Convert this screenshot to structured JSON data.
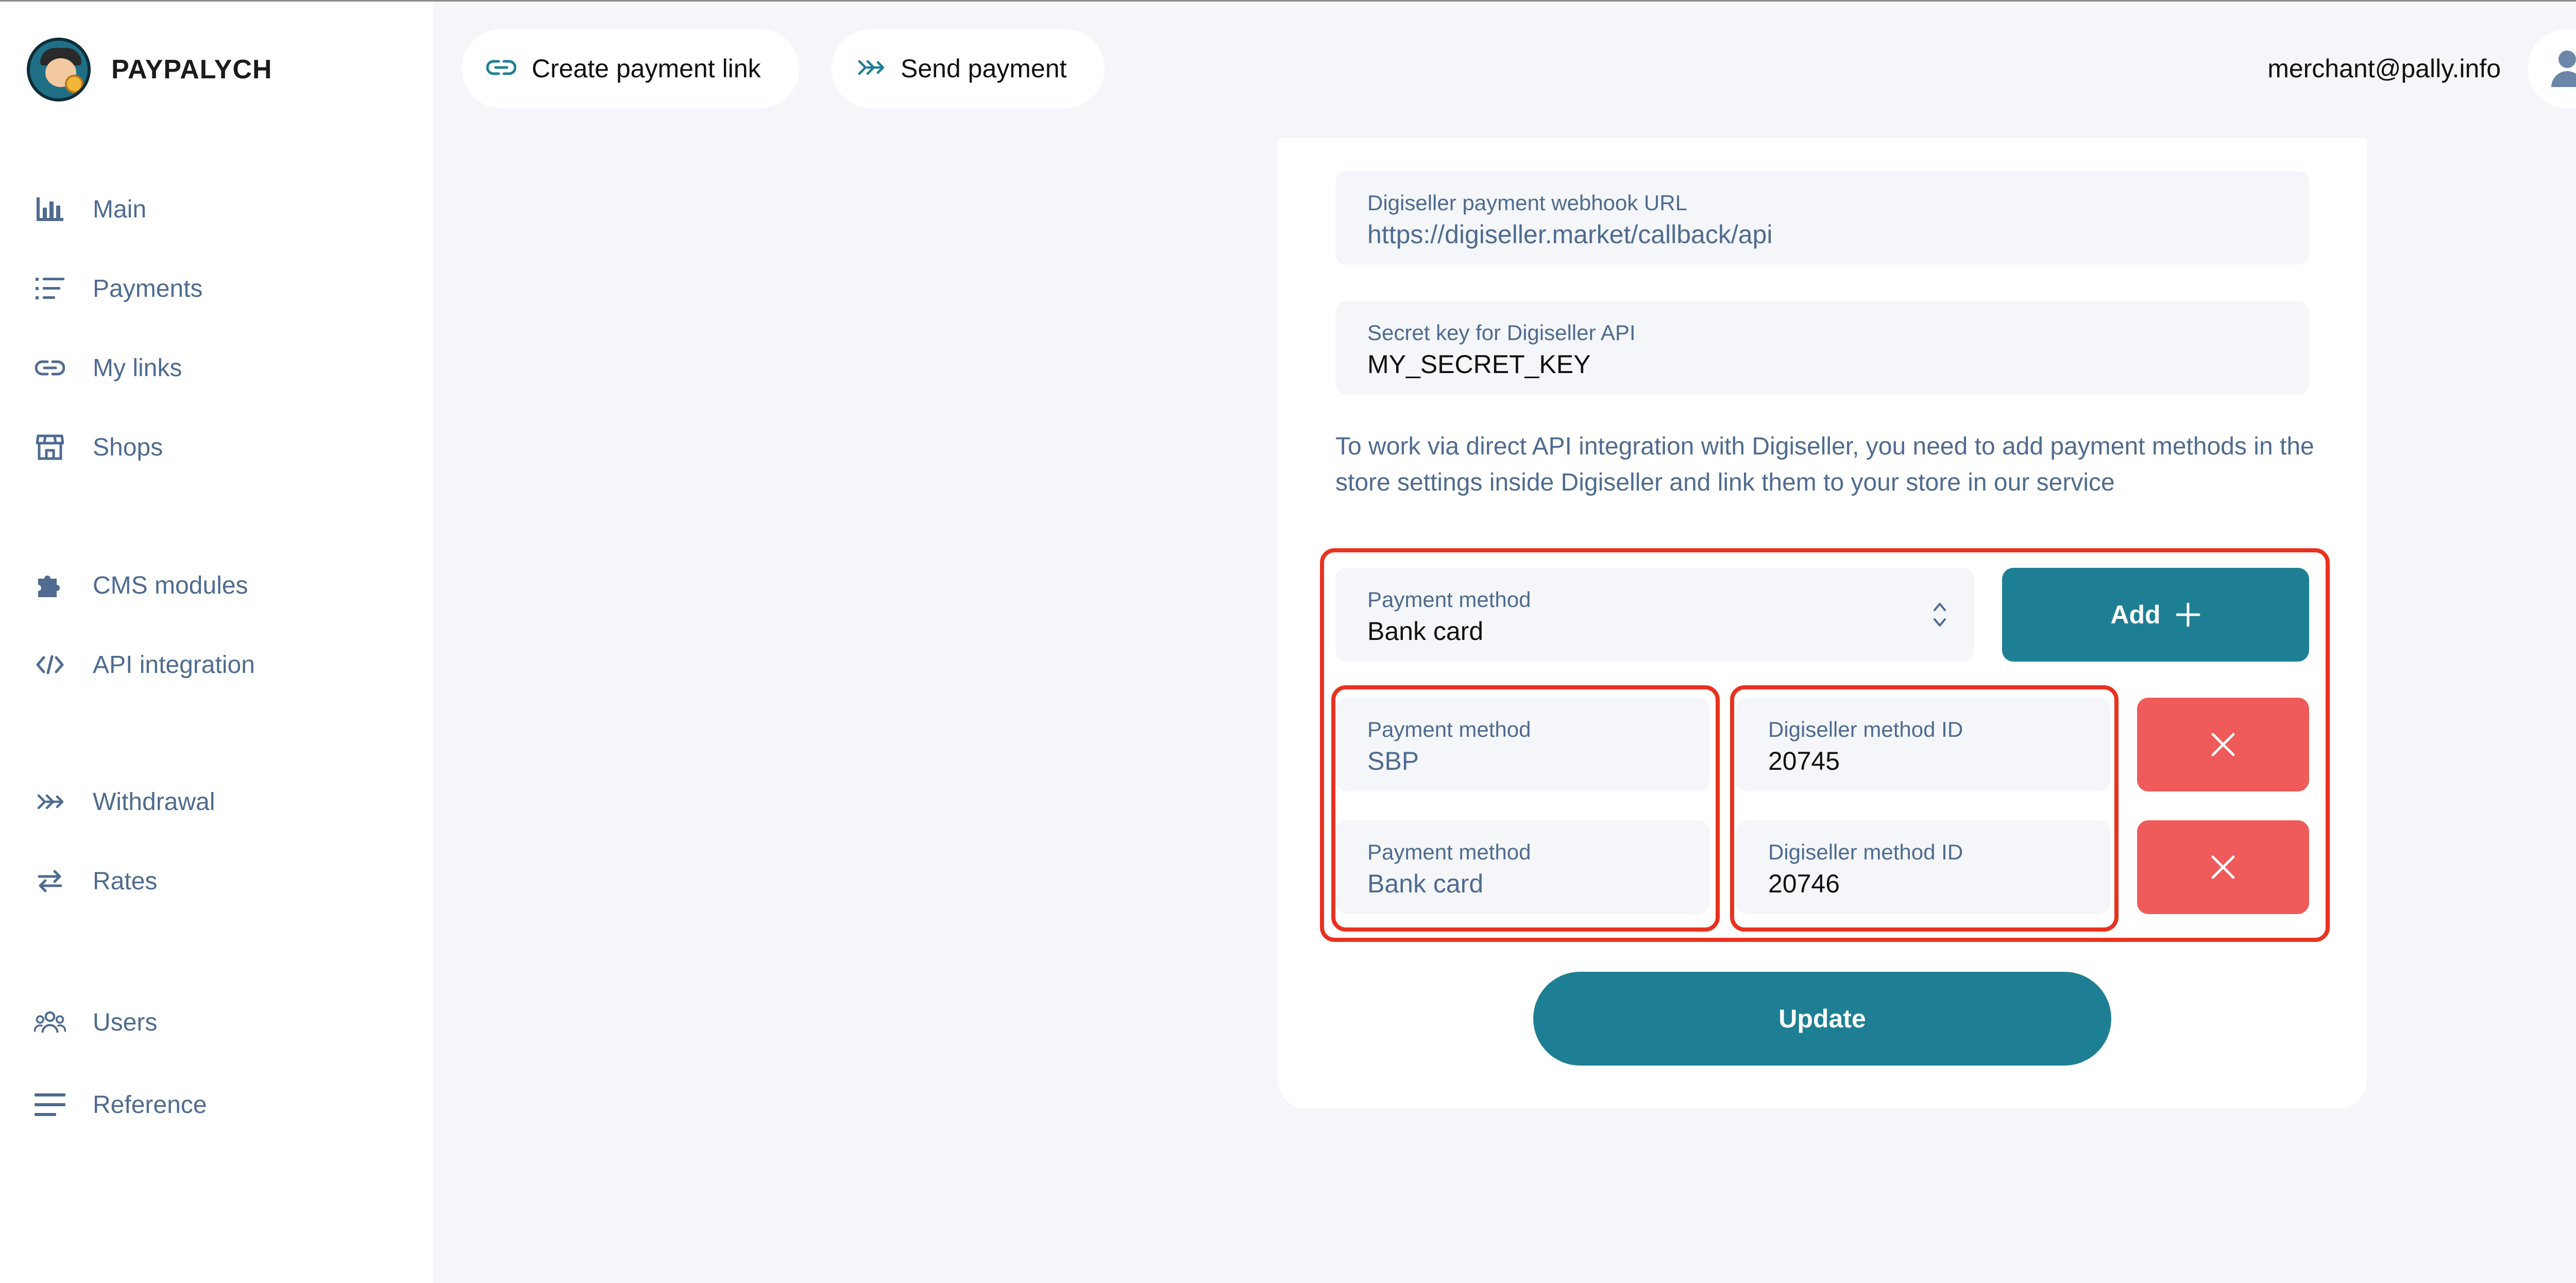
{
  "brand": {
    "name": "PAYPALYCH"
  },
  "sidebar": {
    "items": [
      {
        "label": "Main",
        "icon": "bar-chart-icon"
      },
      {
        "label": "Payments",
        "icon": "list-icon"
      },
      {
        "label": "My links",
        "icon": "link-icon"
      },
      {
        "label": "Shops",
        "icon": "shop-icon"
      },
      {
        "label": "CMS modules",
        "icon": "puzzle-icon"
      },
      {
        "label": "API integration",
        "icon": "code-icon"
      },
      {
        "label": "Withdrawal",
        "icon": "double-arrow-icon"
      },
      {
        "label": "Rates",
        "icon": "swap-icon"
      },
      {
        "label": "Users",
        "icon": "users-icon"
      },
      {
        "label": "Reference",
        "icon": "menu-lines-icon"
      }
    ]
  },
  "header": {
    "create_link_label": "Create payment link",
    "send_payment_label": "Send payment",
    "email": "merchant@pally.info"
  },
  "form": {
    "webhook": {
      "label": "Digiseller payment webhook URL",
      "value": "https://digiseller.market/callback/api"
    },
    "secret": {
      "label": "Secret key for Digiseller API",
      "value": "MY_SECRET_KEY"
    },
    "info": "To work via direct API integration with Digiseller, you need to add payment methods in the store settings inside Digiseller and link them to your store in our service",
    "select": {
      "label": "Payment method",
      "value": "Bank card"
    },
    "add_label": "Add",
    "rows": [
      {
        "method_label": "Payment method",
        "method_value": "SBP",
        "id_label": "Digiseller method ID",
        "id_value": "20745"
      },
      {
        "method_label": "Payment method",
        "method_value": "Bank card",
        "id_label": "Digiseller method ID",
        "id_value": "20746"
      }
    ],
    "update_label": "Update"
  },
  "colors": {
    "accent": "#1e7f94",
    "danger": "#ef5a5a",
    "highlight": "#e8321f",
    "muted_text": "#4f6b8f"
  }
}
